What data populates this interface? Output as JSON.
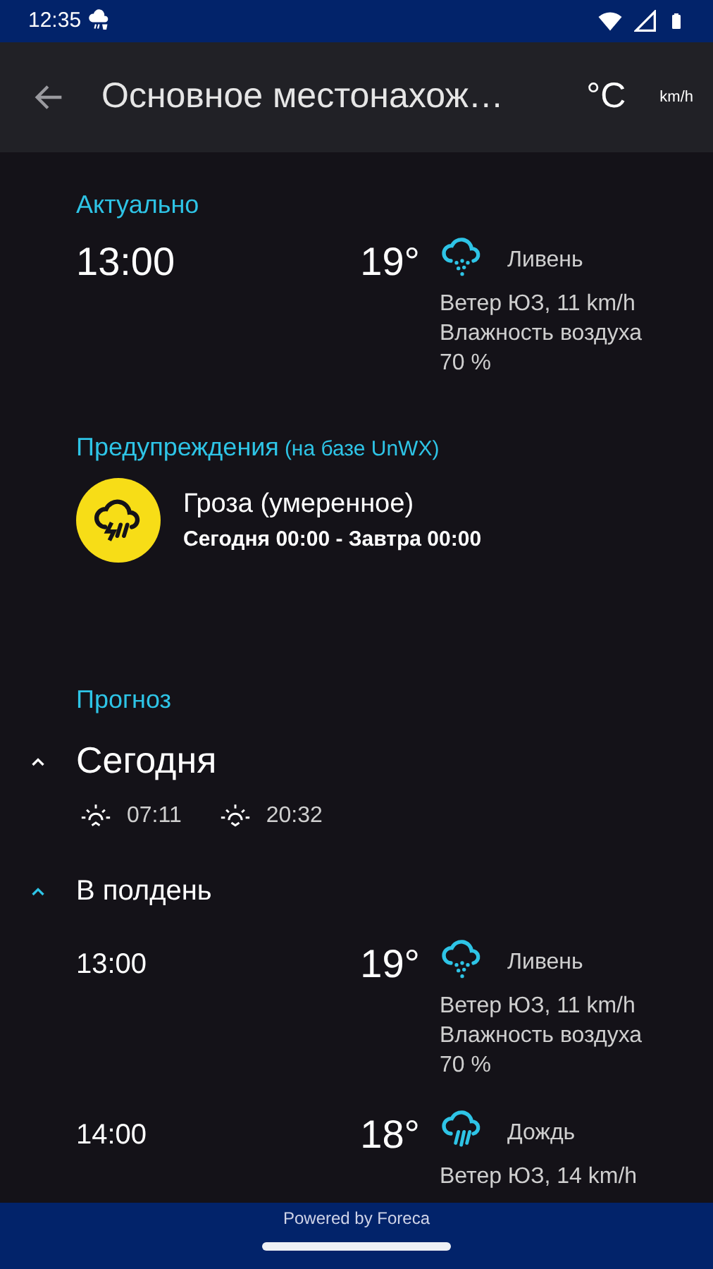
{
  "status_bar": {
    "time": "12:35"
  },
  "toolbar": {
    "title": "Основное местонахож…",
    "temperature_unit": "°C",
    "speed_unit": "km/h"
  },
  "current": {
    "heading": "Актуально",
    "time": "13:00",
    "temperature": "19°",
    "kind": "showers",
    "condition": "Ливень",
    "wind": "Ветер ЮЗ, 11 km/h",
    "humidity": "Влажность воздуха 70 %"
  },
  "warnings": {
    "heading": "Предупреждения",
    "source": "(на базе UnWX)",
    "items": [
      {
        "kind": "thunderstorm",
        "title": "Гроза (умеренное)",
        "period": "Сегодня 00:00 - Завтра 00:00"
      }
    ]
  },
  "forecast": {
    "heading": "Прогноз",
    "days": [
      {
        "label": "Сегодня",
        "expanded": true,
        "sunrise": "07:11",
        "sunset": "20:32",
        "periods": [
          {
            "label": "В полдень",
            "expanded": true,
            "hours": [
              {
                "time": "13:00",
                "temperature": "19°",
                "kind": "showers",
                "condition": "Ливень",
                "wind": "Ветер ЮЗ, 11 km/h",
                "humidity": "Влажность воздуха 70 %"
              },
              {
                "time": "14:00",
                "temperature": "18°",
                "kind": "rain",
                "condition": "Дождь",
                "wind": "Ветер ЮЗ, 14 km/h"
              }
            ]
          }
        ]
      }
    ]
  },
  "footer": {
    "text": "Powered by Foreca"
  }
}
